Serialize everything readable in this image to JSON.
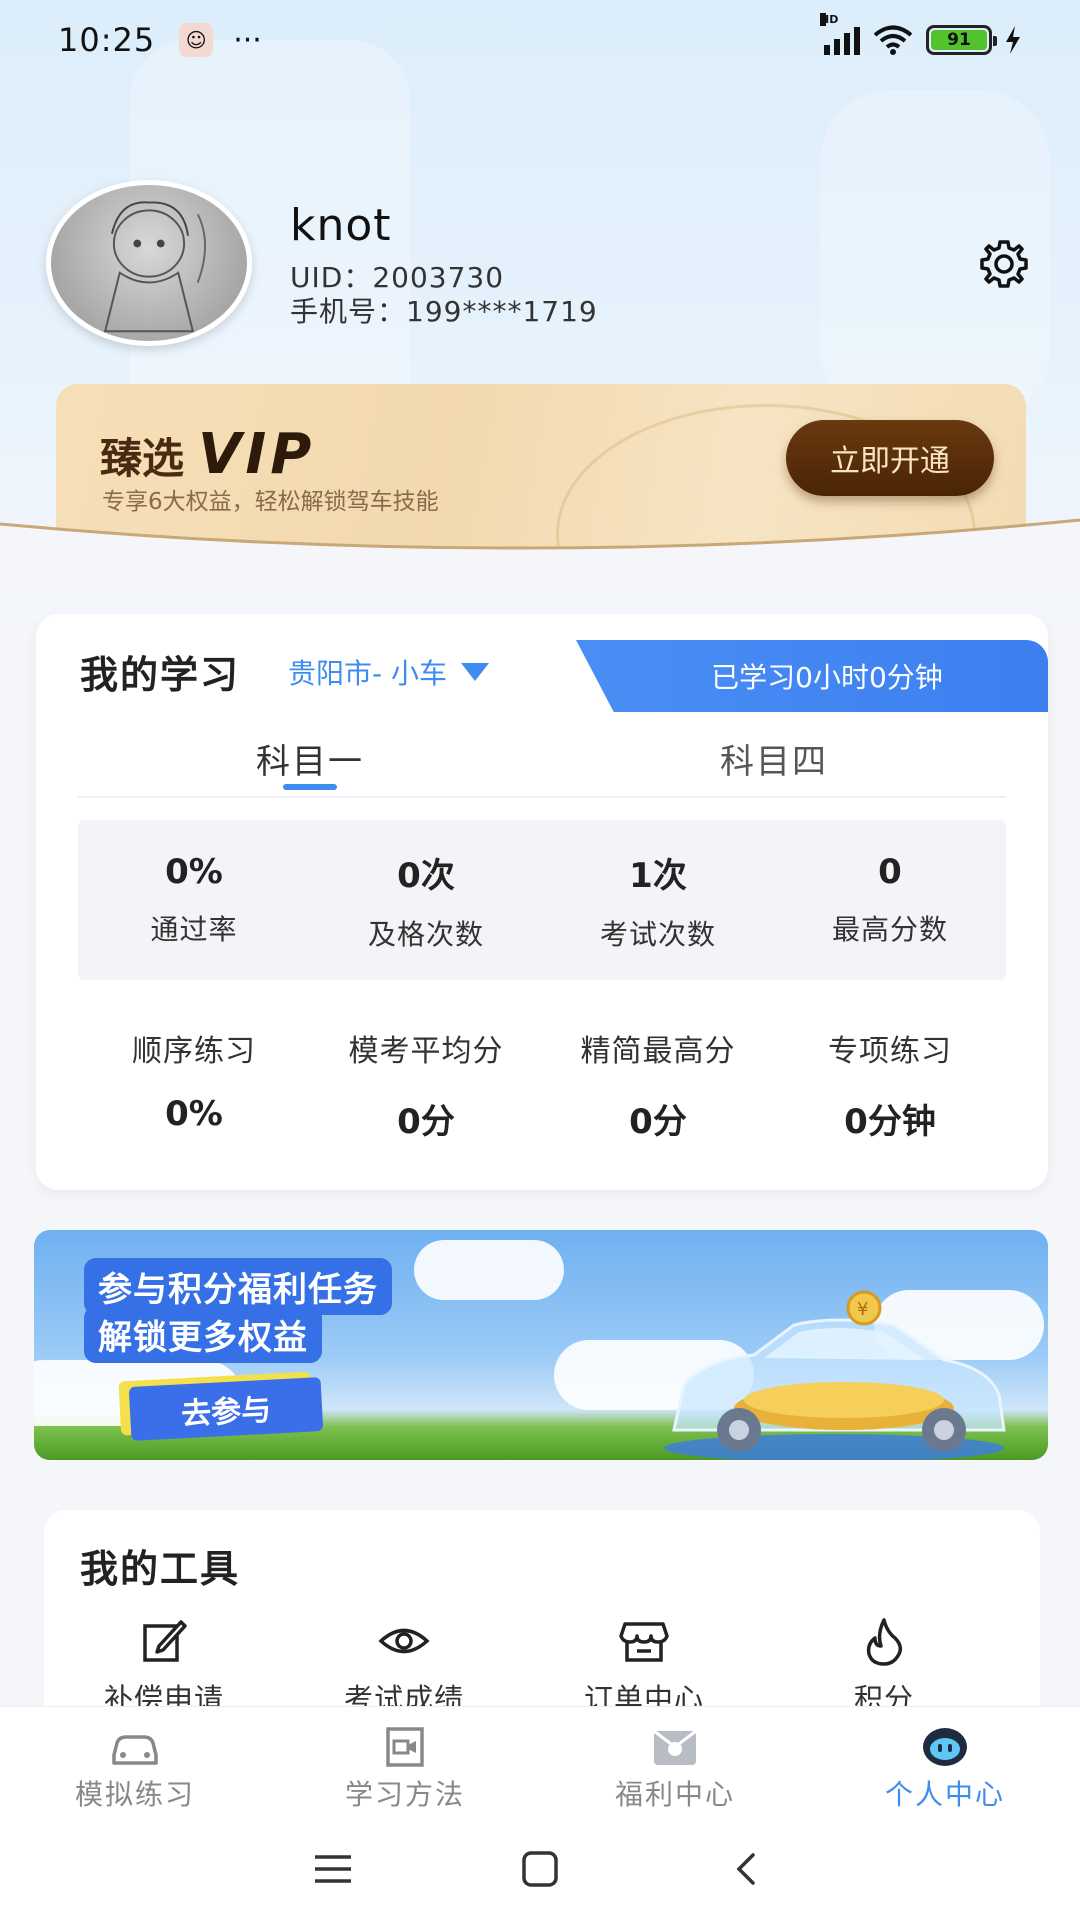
{
  "status_bar": {
    "time": "10:25",
    "dots": "···",
    "network": "HD",
    "battery": "91"
  },
  "profile": {
    "username": "knot",
    "uid": "UID：2003730",
    "phone": "手机号：199****1719"
  },
  "vip": {
    "title_prefix": "臻选",
    "title_vip": "VIP",
    "subtitle": "专享6大权益，轻松解锁驾车技能",
    "button": "立即开通"
  },
  "study": {
    "title": "我的学习",
    "city": "贵阳市- 小车",
    "time_banner": "已学习0小时0分钟",
    "tabs": [
      {
        "label": "科目一",
        "active": true
      },
      {
        "label": "科目四",
        "active": false
      }
    ],
    "stats": [
      {
        "value": "0%",
        "label": "通过率"
      },
      {
        "value": "0次",
        "label": "及格次数"
      },
      {
        "value": "1次",
        "label": "考试次数"
      },
      {
        "value": "0",
        "label": "最高分数"
      }
    ],
    "metrics": [
      {
        "label": "顺序练习",
        "value": "0%"
      },
      {
        "label": "模考平均分",
        "value": "0分"
      },
      {
        "label": "精简最高分",
        "value": "0分"
      },
      {
        "label": "专项练习",
        "value": "0分钟"
      }
    ]
  },
  "promo": {
    "line1": "参与积分福利任务",
    "line2": "解锁更多权益",
    "button": "去参与",
    "coin_symbol": "¥"
  },
  "tools": {
    "title": "我的工具",
    "items": [
      {
        "label": "补偿申请",
        "icon": "edit-icon"
      },
      {
        "label": "考试成绩",
        "icon": "eye-icon"
      },
      {
        "label": "订单中心",
        "icon": "store-icon"
      },
      {
        "label": "积分",
        "icon": "flame-icon"
      }
    ]
  },
  "bottom_nav": {
    "items": [
      {
        "label": "模拟练习",
        "icon": "car-icon",
        "active": false
      },
      {
        "label": "学习方法",
        "icon": "video-icon",
        "active": false
      },
      {
        "label": "福利中心",
        "icon": "gift-icon",
        "active": false
      },
      {
        "label": "个人中心",
        "icon": "robot-icon",
        "active": true
      }
    ]
  },
  "colors": {
    "accent": "#3f8cf0",
    "vip_button": "#5a300c",
    "active_nav": "#3f8cf0"
  }
}
